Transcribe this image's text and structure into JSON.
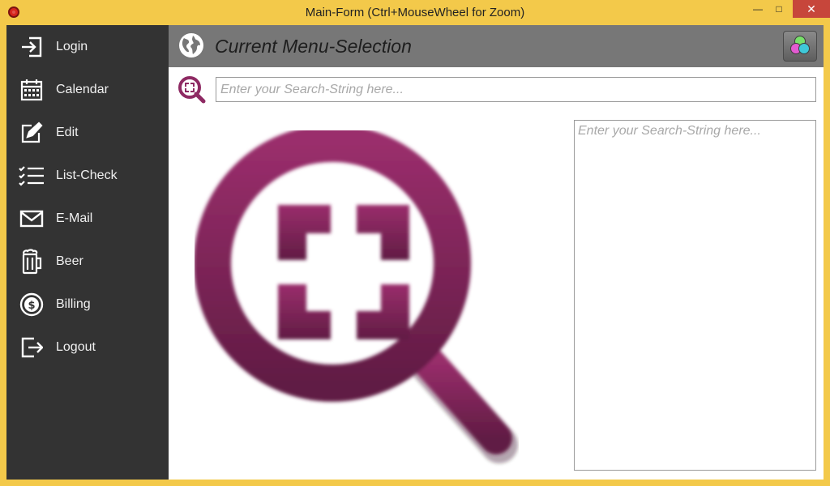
{
  "window": {
    "title": "Main-Form (Ctrl+MouseWheel for Zoom)",
    "min_glyph": "—",
    "max_glyph": "□",
    "close_glyph": "✕"
  },
  "sidebar": {
    "items": [
      {
        "label": "Login",
        "icon": "login-icon"
      },
      {
        "label": "Calendar",
        "icon": "calendar-icon"
      },
      {
        "label": "Edit",
        "icon": "edit-icon"
      },
      {
        "label": "List-Check",
        "icon": "list-check-icon"
      },
      {
        "label": "E-Mail",
        "icon": "mail-icon"
      },
      {
        "label": "Beer",
        "icon": "beer-icon"
      },
      {
        "label": "Billing",
        "icon": "billing-icon"
      },
      {
        "label": "Logout",
        "icon": "logout-icon"
      }
    ]
  },
  "header": {
    "title": "Current Menu-Selection"
  },
  "search": {
    "placeholder": "Enter your Search-String here..."
  },
  "results": {
    "placeholder": "Enter your Search-String here..."
  },
  "colors": {
    "accent": "#8e2a63",
    "sidebar_bg": "#333333",
    "header_bg": "#777777",
    "frame": "#f3c94a"
  }
}
